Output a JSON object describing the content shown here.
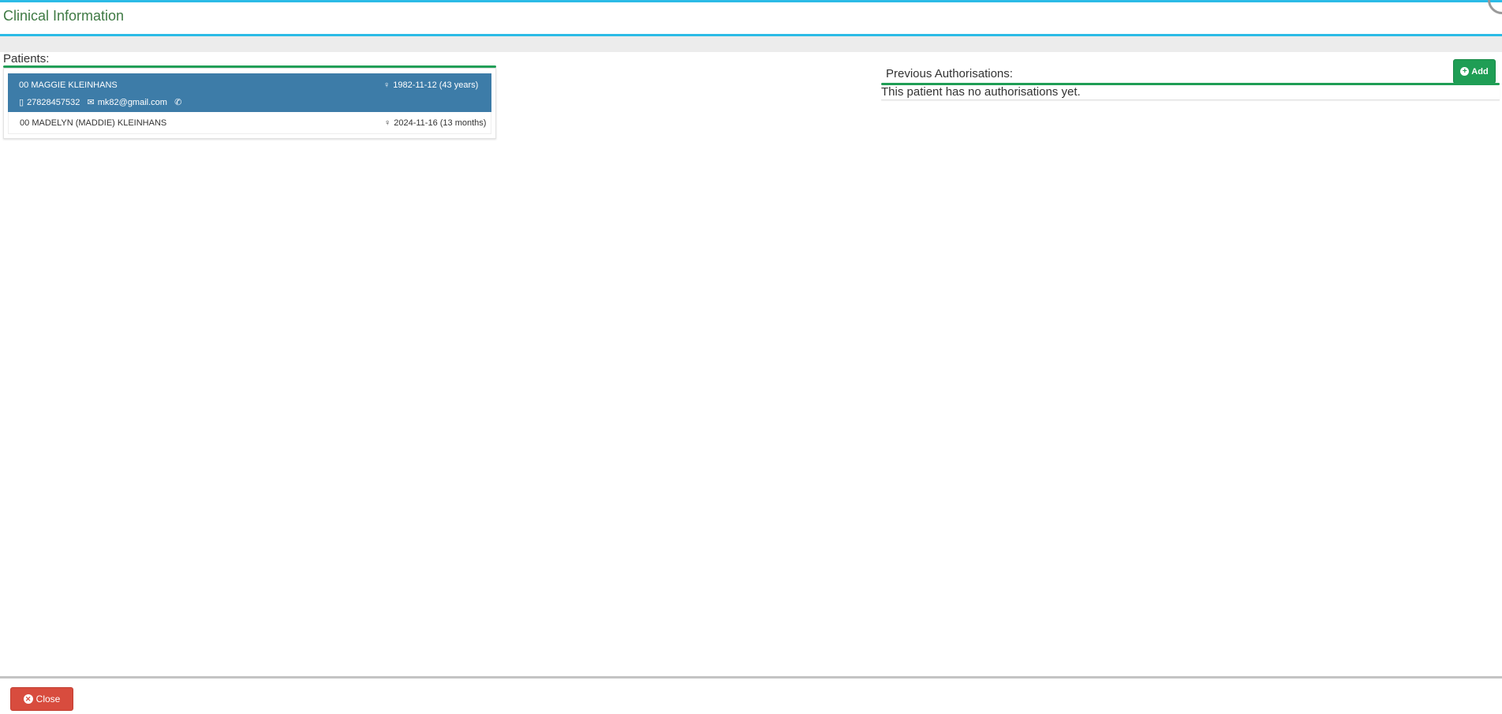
{
  "header": {
    "title": "Clinical Information"
  },
  "patients": {
    "label": "Patients:",
    "items": [
      {
        "code": "00",
        "name": "MAGGIE KLEINHANS",
        "dob": "1982-11-12",
        "age": "(43 years)",
        "phone": "27828457532",
        "email": "mk82@gmail.com",
        "selected": true
      },
      {
        "code": "00",
        "name": "MADELYN (MADDIE) KLEINHANS",
        "dob": "2024-11-16",
        "age": "(13 months)",
        "selected": false
      }
    ]
  },
  "authorisations": {
    "label": "Previous Authorisations:",
    "add_label": "Add",
    "empty_text": "This patient has no authorisations yet."
  },
  "footer": {
    "close_label": "Close"
  },
  "colors": {
    "accent": "#2bbbe6",
    "green": "#1f9e55",
    "selected": "#3d7ca8",
    "danger": "#d84c3e"
  }
}
